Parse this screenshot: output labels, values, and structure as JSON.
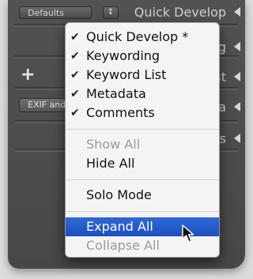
{
  "panel": {
    "preset_select": "Defaults",
    "preset_stepper": "↕",
    "headers": [
      "Quick Develop",
      "g",
      "st",
      "ta",
      "ts"
    ],
    "exif_select": "EXIF and"
  },
  "menu": {
    "items": [
      {
        "label": "Quick Develop *",
        "check": "✔"
      },
      {
        "label": "Keywording",
        "check": "✔"
      },
      {
        "label": "Keyword List",
        "check": "✔"
      },
      {
        "label": "Metadata",
        "check": "✔"
      },
      {
        "label": "Comments",
        "check": "✔"
      }
    ],
    "show_all": "Show All",
    "hide_all": "Hide All",
    "solo_mode": "Solo Mode",
    "expand_all": "Expand All",
    "collapse_all": "Collapse All"
  },
  "colors": {
    "highlight": "#1c4fbf",
    "panel_bg": "#4d4d4d",
    "menu_bg": "#f4f4f4"
  }
}
